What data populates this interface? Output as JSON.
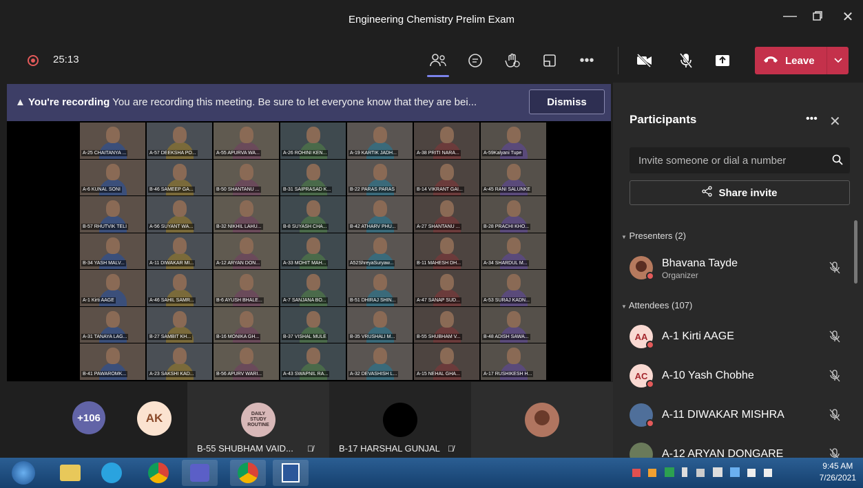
{
  "window": {
    "title": "Engineering Chemistry Prelim Exam"
  },
  "toolbar": {
    "timer": "25:13",
    "leave_label": "Leave"
  },
  "banner": {
    "bold": "You're recording",
    "text": "You are recording this meeting. Be sure to let everyone know that they are bei...",
    "dismiss_label": "Dismiss"
  },
  "grid_names": [
    "A-25 CHAITANYA ...",
    "A-57 DEEKSHA PO...",
    "A-55 APURVA WA...",
    "A-26 ROHINI KEN...",
    "A-19 KARTIK JADH...",
    "A-38 PRITI NARA...",
    "A-59Kalyani Tupe",
    "A-6 KUNAL SONI",
    "B-46 SAMEEP GA...",
    "B-50 SHANTANU ...",
    "B-31 SAIPRASAD K...",
    "B-22 PARAS PARAS",
    "B-14 VIKRANT GAI...",
    "A-45 RANI SALUNKE",
    "B-57 RHUTVIK TELI",
    "A-56 SUYANT WA...",
    "B-32 NIKHIL LAHU...",
    "B-8 SUYASH CHA...",
    "B-42 ATHARV PHU...",
    "A-27 SHANTANU ...",
    "B-28 PRACHI KHO...",
    "B-34 YASH MALV...",
    "A-11 DIWAKAR MI...",
    "A-12 ARYAN DON...",
    "A-33 MOHIT MAH...",
    "A52ShreyaSuryaw...",
    "B-11 MAHESH DH...",
    "A-34 SHARDUL M...",
    "A-1 Kirti AAGE",
    "A-46 SAHIL SAMR...",
    "B-6 AYUSH BHALE...",
    "A-7 SANJANA BO...",
    "B-51 DHIRAJ SHIN...",
    "A-47 SANAP SUD...",
    "A-53 SURAJ KADN...",
    "A-31 TANAYA LAG...",
    "B-27 SAMBIT KH...",
    "B-16 MONIKA GH...",
    "B-37 VISHAL MULE",
    "B-35 VRUSHALI M...",
    "B-55 SHUBHAM V...",
    "B-48 ADISH SAWA...",
    "B-41 PAWAROMK...",
    "A-23 SAKSHI KAD...",
    "B-56 APURV WARI...",
    "A-43 SWAPNIL RA...",
    "A-32 DEVASHISH L...",
    "A-15 NEHAL GHA...",
    "A-17 RUSHIKESH H..."
  ],
  "bottom": {
    "overflow_count": "+106",
    "ak_initials": "AK",
    "tile1_label": "B-55 SHUBHAM VAID...",
    "tile1_poster_lines": [
      "DAILY",
      "STUDY",
      "ROUTINE"
    ],
    "tile2_label": "B-17 HARSHAL GUNJAL"
  },
  "participants": {
    "header": "Participants",
    "invite_placeholder": "Invite someone or dial a number",
    "share_label": "Share invite",
    "presenters_label": "Presenters (2)",
    "attendees_label": "Attendees (107)",
    "presenter": {
      "name": "Bhavana Tayde",
      "role": "Organizer"
    },
    "attendees": [
      {
        "initials": "AA",
        "name": "A-1 Kirti AAGE",
        "color": "#f9d9d2",
        "text": "#a4262c"
      },
      {
        "initials": "AC",
        "name": "A-10 Yash Chobhe",
        "color": "#f9d9d2",
        "text": "#a4262c"
      },
      {
        "initials": "",
        "name": "A-11 DIWAKAR MISHRA",
        "color": "#4f6f9a",
        "text": "#fff"
      },
      {
        "initials": "",
        "name": "A-12 ARYAN DONGARE",
        "color": "#6a7a5a",
        "text": "#fff"
      }
    ]
  },
  "taskbar": {
    "time": "9:45 AM",
    "date": "7/26/2021"
  },
  "colors": {
    "accent": "#7b83eb",
    "leave": "#c4314b",
    "banner": "#3d3e66",
    "recording": "#e35a5a"
  }
}
